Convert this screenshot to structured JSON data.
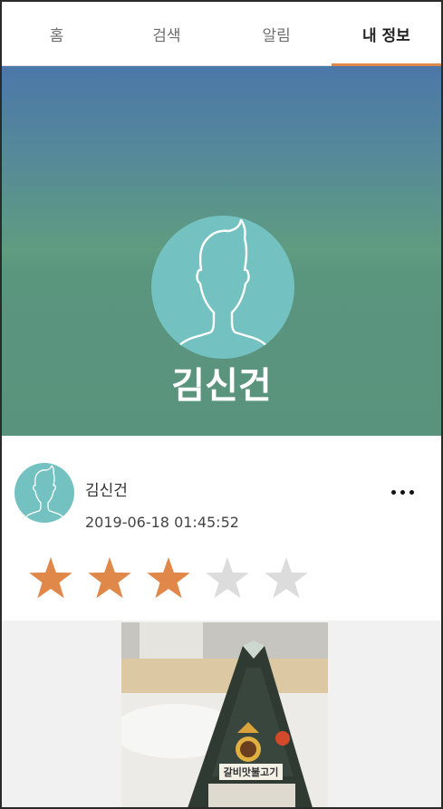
{
  "tabs": [
    {
      "label": "홈",
      "active": false
    },
    {
      "label": "검색",
      "active": false
    },
    {
      "label": "알림",
      "active": false
    },
    {
      "label": "내 정보",
      "active": true
    }
  ],
  "profile": {
    "name": "김신건"
  },
  "post": {
    "author": "김신건",
    "timestamp": "2019-06-18 01:45:52",
    "rating": 3,
    "rating_max": 5,
    "more_icon": "more-horizontal-icon",
    "photo_label_text": "갈비맛불고기"
  },
  "colors": {
    "accent": "#e0884a",
    "star_filled": "#e0884a",
    "star_empty": "#dcdcdc",
    "avatar_bg": "#74c1c1",
    "banner_top": "#4b77a9",
    "banner_bottom": "#5a937d"
  }
}
